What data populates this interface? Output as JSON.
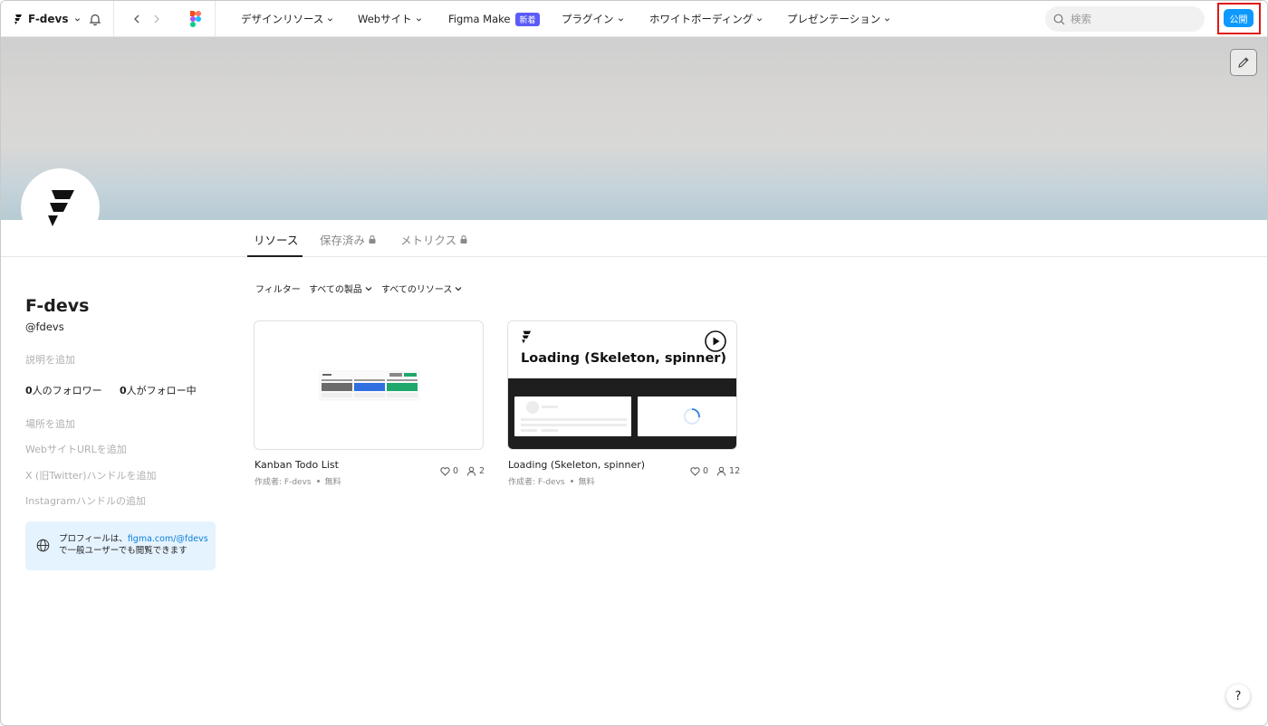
{
  "topbar": {
    "team_name": "F-devs",
    "nav": [
      {
        "label": "デザインリソース",
        "has_chevron": true
      },
      {
        "label": "Webサイト",
        "has_chevron": true
      },
      {
        "label": "Figma Make",
        "badge": "新着"
      },
      {
        "label": "プラグイン",
        "has_chevron": true
      },
      {
        "label": "ホワイトボーディング",
        "has_chevron": true
      },
      {
        "label": "プレゼンテーション",
        "has_chevron": true
      }
    ],
    "search_placeholder": "検索",
    "publish_label": "公開"
  },
  "tabs": [
    {
      "label": "リソース",
      "active": true,
      "locked": false
    },
    {
      "label": "保存済み",
      "active": false,
      "locked": true
    },
    {
      "label": "メトリクス",
      "active": false,
      "locked": true
    }
  ],
  "profile": {
    "name": "F-devs",
    "handle": "@fdevs",
    "add_description": "説明を追加",
    "followers_count": "0",
    "followers_label": "人のフォロワー",
    "following_count": "0",
    "following_label": "人がフォロー中",
    "add_location": "場所を追加",
    "add_website": "WebサイトURLを追加",
    "add_twitter": "X (旧Twitter)ハンドルを追加",
    "add_instagram": "Instagramハンドルの追加",
    "notice_prefix": "プロフィールは、",
    "notice_link": "figma.com/@fdevs",
    "notice_suffix": "で一般ユーザーでも閲覧できます"
  },
  "filters": {
    "label": "フィルター",
    "products": "すべての製品",
    "resources": "すべてのリソース"
  },
  "cards": [
    {
      "title": "Kanban Todo List",
      "author": "作成者: F-devs",
      "price": "無料",
      "likes": "0",
      "users": "2"
    },
    {
      "title": "Loading (Skeleton, spinner)",
      "thumb_title": "Loading (Skeleton, spinner)",
      "author": "作成者: F-devs",
      "price": "無料",
      "likes": "0",
      "users": "12"
    }
  ],
  "help_label": "?",
  "colors": {
    "accent": "#0d99ff",
    "badge": "#5b5bf7",
    "highlight": "#e01818"
  }
}
